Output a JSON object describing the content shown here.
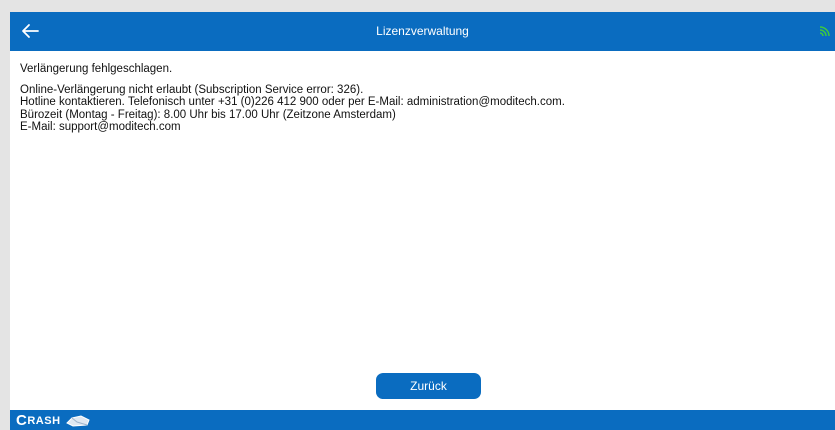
{
  "header": {
    "title": "Lizenzverwaltung",
    "back_icon": "arrow-left-icon",
    "signal_icon": "wifi-signal-icon"
  },
  "message": {
    "heading": "Verlängerung fehlgeschlagen.",
    "lines": [
      "Online-Verlängerung nicht erlaubt (Subscription Service error: 326).",
      "Hotline kontaktieren. Telefonisch unter +31 (0)226 412 900 oder per E-Mail: administration@moditech.com.",
      "Bürozeit (Montag - Freitag): 8.00 Uhr bis 17.00 Uhr (Zeitzone Amsterdam)",
      "E-Mail: support@moditech.com"
    ]
  },
  "actions": {
    "back_label": "Zurück"
  },
  "footer": {
    "logo_first": "C",
    "logo_rest": "RASH"
  },
  "colors": {
    "brand_blue": "#0a6cc0",
    "signal_green": "#3ec93e",
    "background": "#e4e4e4"
  }
}
